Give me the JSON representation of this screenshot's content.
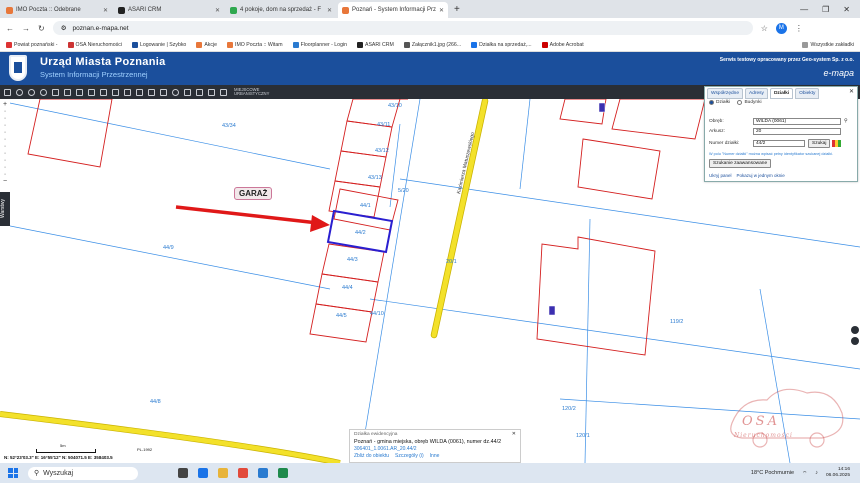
{
  "browser": {
    "tabs": [
      {
        "title": "IMO Poczta :: Odebrane",
        "color": "#e8773a"
      },
      {
        "title": "ASARI CRM",
        "color": "#222222"
      },
      {
        "title": "4 pokoje, dom na sprzedaż - F",
        "color": "#2fa84f"
      },
      {
        "title": "Poznań - System Informacji Prz",
        "color": "#e8773a",
        "active": true
      }
    ],
    "url": "poznan.e-mapa.net",
    "profile_initial": "M",
    "bookmarks": [
      {
        "label": "Powiat poznański -",
        "color": "#d33"
      },
      {
        "label": "OSA Nieruchomości",
        "color": "#c33"
      },
      {
        "label": "Logowanie | Szybko",
        "color": "#1b4f9c"
      },
      {
        "label": "Akcje",
        "color": "#e8773a"
      },
      {
        "label": "IMO Poczta :: Witam",
        "color": "#e8773a"
      },
      {
        "label": "Floorplanner - Login",
        "color": "#2a7bd0"
      },
      {
        "label": "ASARI CRM",
        "color": "#222"
      },
      {
        "label": "Załącznik1.jpg (266...",
        "color": "#555"
      },
      {
        "label": "Działka na sprzedaż,...",
        "color": "#1a73e8"
      },
      {
        "label": "Adobe Acrobat",
        "color": "#c00"
      }
    ],
    "bookmarks_right": "Wszystkie zakładki"
  },
  "header": {
    "title": "Urząd Miasta Poznania",
    "subtitle": "System Informacji Przestrzennej",
    "service_note": "Serwis testowy opracowany przez Geo-system Sp. z o.o.",
    "brand": "e-mapa"
  },
  "toolbar": {
    "layer_label_line1": "MIEJSCOWE",
    "layer_label_line2": "URBANISTYCZNY"
  },
  "side": {
    "panel_label": "Warstwy"
  },
  "search_panel": {
    "tabs": [
      "Współrzędne",
      "Adresy",
      "Działki",
      "Obiekty"
    ],
    "active_tab": "Działki",
    "mode_options": [
      "Działki",
      "Budynki"
    ],
    "obreb_label": "Obręb:",
    "obreb_value": "WILDA (0061)",
    "arkusz_label": "Arkusz:",
    "arkusz_value": "20",
    "numer_label": "Numer działki:",
    "numer_value": "44/2",
    "search_button": "Szukaj",
    "hint": "W polu \"Numer działki\" można wpisać pełny identyfikator szukanej działki.",
    "advanced_button": "Szukanie zaawansowane",
    "links": [
      "Ukryj panel",
      "Pokazuj w jednym oknie"
    ]
  },
  "map": {
    "parcels": [
      "43/10",
      "43/11",
      "43/12",
      "43/13",
      "44/1",
      "44/2",
      "44/3",
      "44/4",
      "44/5",
      "44/10",
      "43/34",
      "44/9",
      "44/8",
      "119/2",
      "120/2",
      "120/1",
      "5/20",
      "20/1"
    ],
    "street_label": "Kazimierza Matuszewskiego",
    "annotation": "GARAŻ"
  },
  "info_box": {
    "title": "Działka ewidencyjna",
    "line1": "Poznań - gmina miejska, obręb WILDA (0061), numer dz.44/2",
    "line2": "306401_1.0061.AR_20.44/2",
    "links": [
      "Zbliż do obiektu",
      "Szczegóły (i)",
      "Inne"
    ]
  },
  "statusbar": {
    "coords": "N: 52°23'03.3\"  E: 16°55'12\"   N: 504071.5   E: 358403.5",
    "scale_label": "5m",
    "crs": "PL-1992"
  },
  "watermark": {
    "name": "OSA",
    "sub": "Nieruchomości"
  },
  "taskbar": {
    "search_placeholder": "Wyszukaj",
    "weather": "18°C  Pochmurnie",
    "time": "14:16",
    "date": "06.06.2025"
  }
}
